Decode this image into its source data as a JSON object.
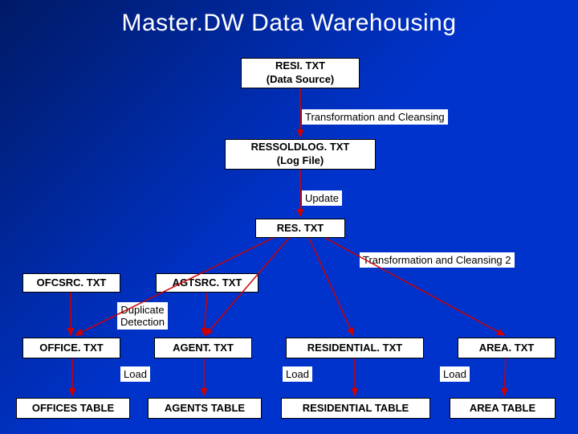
{
  "title": "Master.DW Data Warehousing",
  "nodes": {
    "resi": {
      "line1": "RESI. TXT",
      "line2": "(Data Source)"
    },
    "transform1": "Transformation and Cleansing",
    "ressoldlog": {
      "line1": "RESSOLDLOG. TXT",
      "line2": "(Log File)"
    },
    "update": "Update",
    "res": "RES. TXT",
    "transform2": "Transformation and Cleansing 2",
    "ofcsrc": "OFCSRC. TXT",
    "agtsrc": "AGTSRC. TXT",
    "dupdetect": "Duplicate\nDetection",
    "office": "OFFICE. TXT",
    "agent": "AGENT. TXT",
    "residential": "RESIDENTIAL. TXT",
    "area": "AREA. TXT",
    "load1": "Load",
    "load2": "Load",
    "load3": "Load",
    "offices_table": "OFFICES TABLE",
    "agents_table": "AGENTS TABLE",
    "residential_table": "RESIDENTIAL TABLE",
    "area_table": "AREA TABLE"
  }
}
